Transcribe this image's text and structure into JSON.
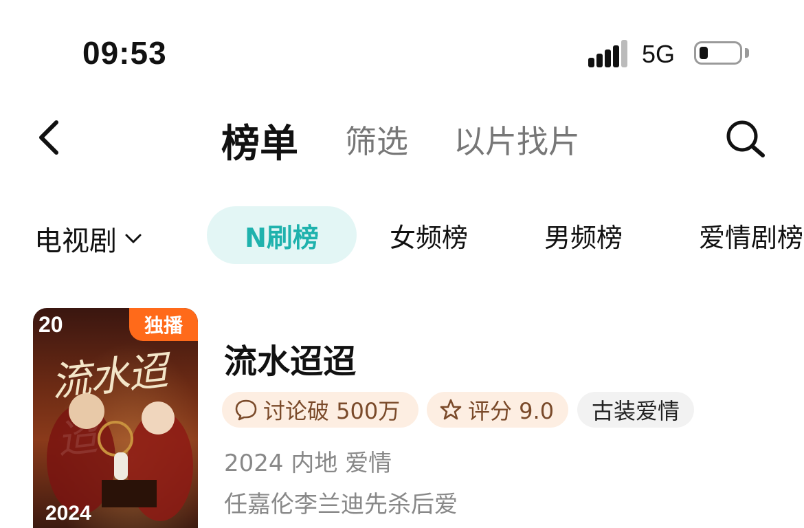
{
  "status_bar": {
    "time": "09:53",
    "network": "5G"
  },
  "nav": {
    "tabs": [
      {
        "label": "榜单"
      },
      {
        "label": "筛选"
      },
      {
        "label": "以片找片"
      }
    ]
  },
  "category": {
    "selected": "电视剧",
    "rank_tabs": [
      "N刷榜",
      "女频榜",
      "男频榜",
      "爱情剧榜"
    ]
  },
  "item": {
    "rank": "20",
    "badge": "独播",
    "poster_title": "流水迢迢",
    "poster_year": "2024",
    "title": "流水迢迢",
    "tags": {
      "discuss": "讨论破 500万",
      "rating": "评分 9.0",
      "genre": "古装爱情"
    },
    "meta": "2024 内地 爱情",
    "desc": "任嘉伦李兰迪先杀后爱"
  },
  "colors": {
    "accent": "#1fb2ad",
    "accent_bg": "#e3f6f5",
    "badge": "#ff6a1a",
    "tag_bg": "#fdeee2"
  }
}
